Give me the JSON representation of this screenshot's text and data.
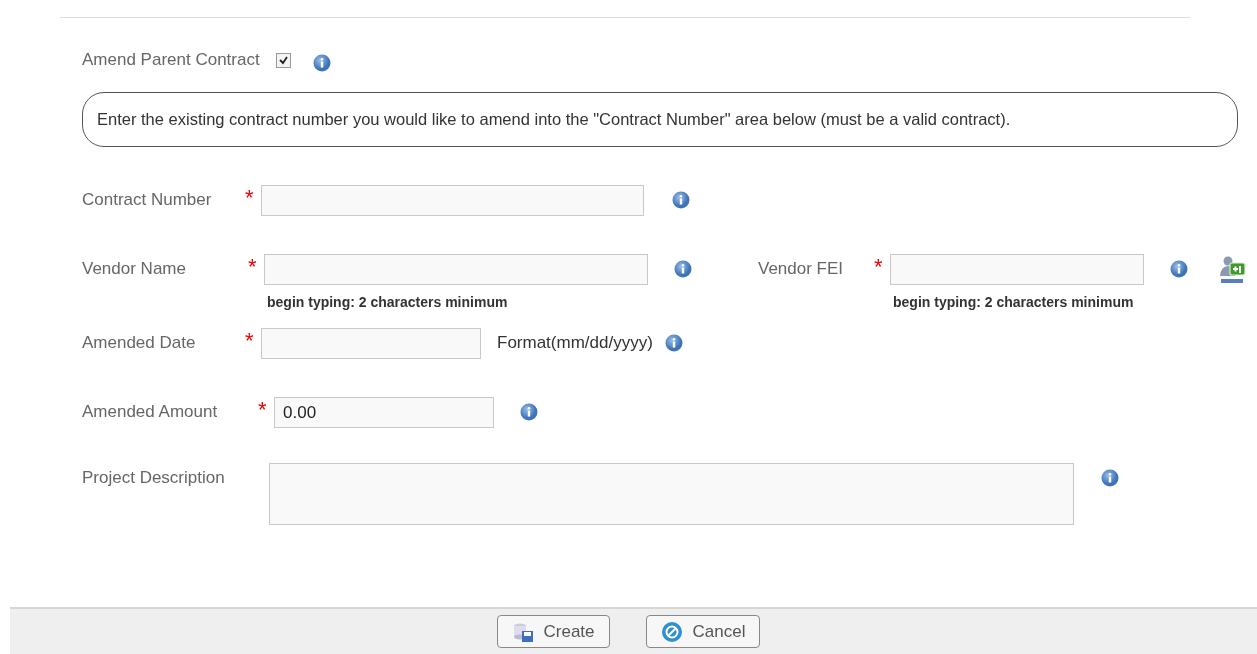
{
  "amend_parent": {
    "label": "Amend Parent Contract",
    "checked": true
  },
  "notice": "Enter the existing contract number you would like to amend into the \"Contract Number\" area below (must be a valid contract).",
  "rows": [
    {
      "fields": [
        {
          "kind": "text",
          "label": "Contract Number",
          "required": true,
          "required_mark": "*"
        }
      ]
    },
    {
      "fields": [
        {
          "kind": "text",
          "label": "Vendor Name",
          "required": true,
          "required_mark": "*",
          "hint": "begin typing: 2 characters minimum"
        },
        {
          "kind": "text",
          "label": "Vendor FEI",
          "required": true,
          "required_mark": "*",
          "hint": "begin typing: 2 characters minimum",
          "add_vendor": true
        }
      ]
    },
    {
      "fields": [
        {
          "kind": "text",
          "label": "Amended Date",
          "required": true,
          "required_mark": "*",
          "suffix": "Format(mm/dd/yyyy)"
        }
      ]
    },
    {
      "fields": [
        {
          "kind": "text",
          "label": "Amended Amount",
          "required": true,
          "required_mark": "*",
          "value": "0.00"
        }
      ]
    },
    {
      "fields": [
        {
          "kind": "textarea",
          "label": "Project Description",
          "required": false
        }
      ]
    }
  ],
  "buttons": [
    {
      "kind": "create",
      "label": "Create"
    },
    {
      "kind": "cancel",
      "label": "Cancel"
    }
  ]
}
